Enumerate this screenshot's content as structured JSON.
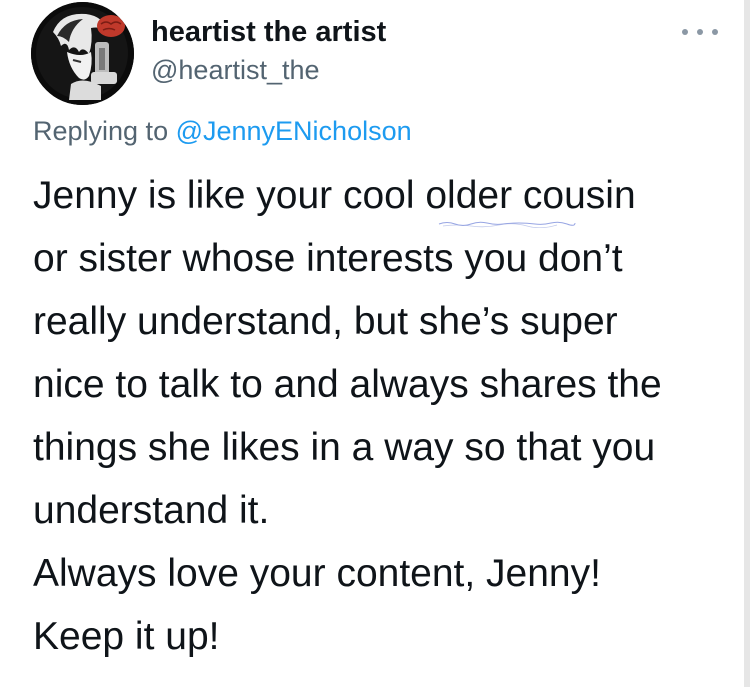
{
  "author": {
    "name": "heartist the artist",
    "handle": "@heartist_the"
  },
  "reply": {
    "prefix": "Replying to ",
    "mention": "@JennyENicholson"
  },
  "tweet": {
    "lines": [
      "Jenny is like your cool older cousin",
      "or sister whose interests you don’t",
      "really understand, but she’s super",
      "nice to talk to and always shares the",
      "things she likes in a way so that you",
      "understand it.",
      "Always love your content, Jenny!",
      "Keep it up!"
    ]
  },
  "icons": {
    "avatar": "profile-picture",
    "menu": "more-options-icon"
  },
  "colors": {
    "text": "#0f1419",
    "secondary": "#536471",
    "link": "#1d9bf0"
  }
}
